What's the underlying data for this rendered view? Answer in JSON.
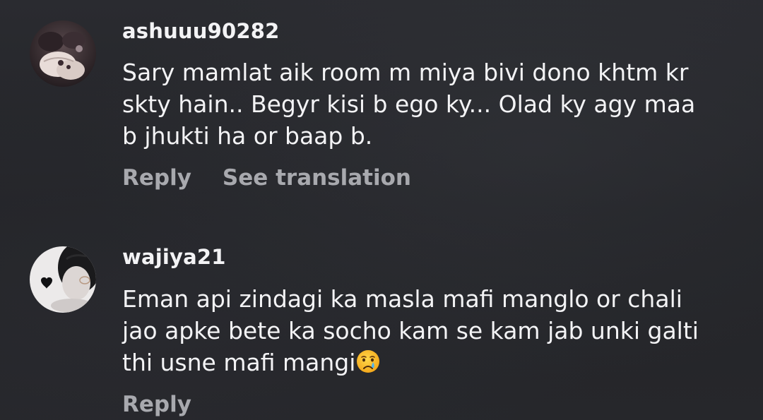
{
  "colors": {
    "background": "#26272b",
    "primary_text": "#f3f3f5",
    "secondary_text": "#a8a9ae"
  },
  "comments": [
    {
      "username": "ashuuu90282",
      "text": "Sary mamlat aik room m miya bivi  dono khtm kr\nskty hain.. Begyr kisi b ego ky... Olad ky agy maa\nb jhukti ha or baap b.",
      "actions": {
        "reply": "Reply",
        "see_translation": "See translation"
      },
      "avatar_icon": "user-avatar-hands-icon"
    },
    {
      "username": "wajiya21",
      "text": "Eman api zindagi ka masla mafi manglo or chali\njao apke bete ka socho kam se kam jab unki galti\nthi usne mafi mangi",
      "emoji": "crying-face-icon",
      "actions": {
        "reply": "Reply"
      },
      "avatar_icon": "user-avatar-girl-icon"
    }
  ]
}
